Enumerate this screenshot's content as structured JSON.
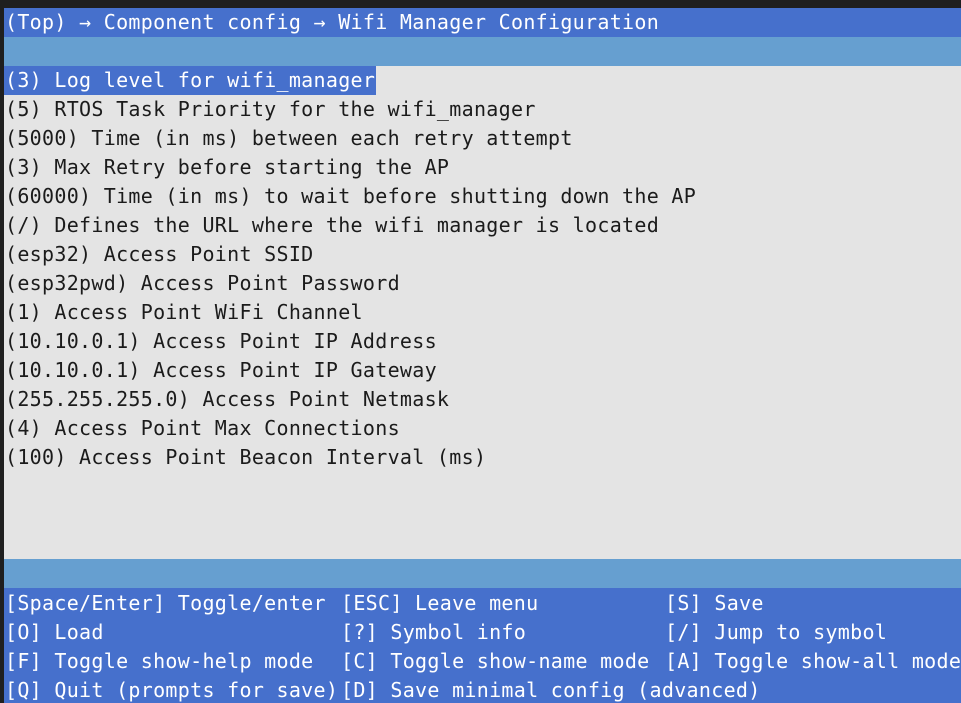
{
  "breadcrumb": "(Top) → Component config → Wifi Manager Configuration",
  "menu_items": [
    "(3) Log level for wifi_manager",
    "(5) RTOS Task Priority for the wifi_manager",
    "(5000) Time (in ms) between each retry attempt",
    "(3) Max Retry before starting the AP",
    "(60000) Time (in ms) to wait before shutting down the AP",
    "(/) Defines the URL where the wifi manager is located",
    "(esp32) Access Point SSID",
    "(esp32pwd) Access Point Password",
    "(1) Access Point WiFi Channel",
    "(10.10.0.1) Access Point IP Address",
    "(10.10.0.1) Access Point IP Gateway",
    "(255.255.255.0) Access Point Netmask",
    "(4) Access Point Max Connections",
    "(100) Access Point Beacon Interval (ms)"
  ],
  "help": {
    "space_enter": "[Space/Enter] Toggle/enter",
    "esc": "[ESC] Leave menu",
    "save": "[S] Save",
    "load": "[O] Load",
    "symbol_info": "[?] Symbol info",
    "jump": "[/] Jump to symbol",
    "show_help": "[F] Toggle show-help mode",
    "show_name": "[C] Toggle show-name mode",
    "show_all": "[A] Toggle show-all mode",
    "quit": "[Q] Quit (prompts for save)",
    "save_minimal": "[D] Save minimal config (advanced)"
  },
  "colors": {
    "bar": "#4670cc",
    "separator": "#669fd0",
    "background": "#e4e4e4",
    "text": "#1b1b1b"
  }
}
